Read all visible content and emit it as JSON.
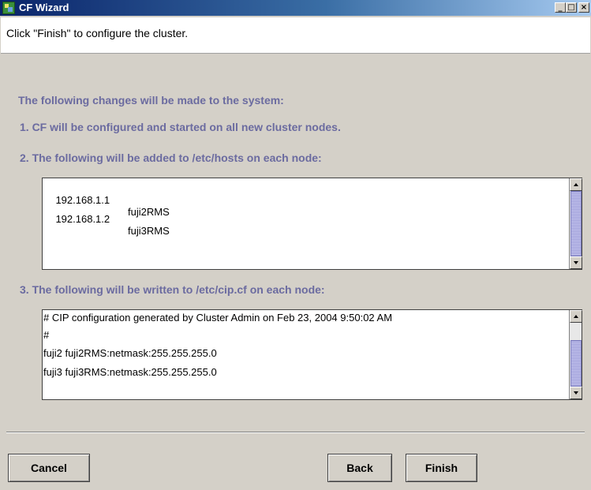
{
  "window": {
    "title": "CF Wizard",
    "controls": {
      "minimize": "_",
      "maximize": "□",
      "close": "×"
    }
  },
  "instruction": "Click \"Finish\" to configure the cluster.",
  "content": {
    "heading": "The following changes will be made to the system:",
    "item1": "1.   CF will be configured and started on all new cluster nodes.",
    "item2": "2.   The following will be added to /etc/hosts on each node:",
    "hosts": [
      {
        "ip": "192.168.1.1",
        "name": "fuji2RMS"
      },
      {
        "ip": "192.168.1.2",
        "name": "fuji3RMS"
      }
    ],
    "item3": "3.   The following will be written to /etc/cip.cf on each node:",
    "cip_lines": [
      "# CIP configuration generated by Cluster Admin on Feb 23, 2004 9:50:02 AM",
      "#",
      "fuji2 fuji2RMS:netmask:255.255.255.0",
      "fuji3 fuji3RMS:netmask:255.255.255.0"
    ]
  },
  "buttons": {
    "cancel": "Cancel",
    "back": "Back",
    "finish": "Finish"
  }
}
